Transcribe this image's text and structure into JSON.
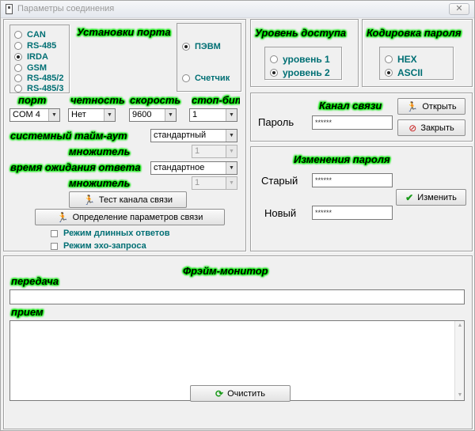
{
  "window": {
    "title": "Параметры соединения",
    "close_glyph": "✕"
  },
  "port_settings": {
    "heading": "Установки порта",
    "interfaces": [
      {
        "label": "CAN",
        "checked": false
      },
      {
        "label": "RS-485",
        "checked": false
      },
      {
        "label": "IRDA",
        "checked": true
      },
      {
        "label": "GSM",
        "checked": false
      },
      {
        "label": "RS-485/2",
        "checked": false
      },
      {
        "label": "RS-485/3",
        "checked": false
      }
    ],
    "device": [
      {
        "label": "ПЭВМ",
        "checked": true
      },
      {
        "label": "Счетчик",
        "checked": false
      }
    ],
    "port_label": "порт",
    "port_value": "COM 4",
    "parity_label": "четность",
    "parity_value": "Нет",
    "speed_label": "скорость",
    "speed_value": "9600",
    "stopbits_label": "стоп-биты",
    "stopbits_value": "1",
    "timeout_label": "системный тайм-аут",
    "timeout_value": "стандартный",
    "mult1_label": "множитель",
    "mult1_value": "1",
    "wait_label": "время ожидания ответа",
    "wait_value": "стандартное",
    "mult2_label": "множитель",
    "mult2_value": "1",
    "test_button": "Тест канала связи",
    "detect_button": "Определение параметров связи",
    "long_answers": "Режим длинных ответов",
    "echo_request": "Режим эхо-запроса"
  },
  "access_level": {
    "heading": "Уровень доступа",
    "options": [
      {
        "label": "уровень 1",
        "checked": false
      },
      {
        "label": "уровень 2",
        "checked": true
      }
    ]
  },
  "password_encoding": {
    "heading": "Кодировка пароля",
    "options": [
      {
        "label": "HEX",
        "checked": false
      },
      {
        "label": "ASCII",
        "checked": true
      }
    ]
  },
  "channel": {
    "heading": "Канал связи",
    "password_label": "Пароль",
    "password_value": "******",
    "open_button": "Открыть",
    "close_button": "Закрыть"
  },
  "change_password": {
    "heading": "Изменения пароля",
    "old_label": "Старый",
    "old_value": "******",
    "new_label": "Новый",
    "new_value": "******",
    "change_button": "Изменить"
  },
  "frame_monitor": {
    "heading": "Фрэйм-монитор",
    "send_label": "передача",
    "send_value": "",
    "receive_label": "прием",
    "clear_button": "Очистить"
  },
  "colors": {
    "glow": "#00f000",
    "teal_text": "#006f74",
    "accent_check": "#1a9a1a",
    "close_red": "#c81818"
  }
}
